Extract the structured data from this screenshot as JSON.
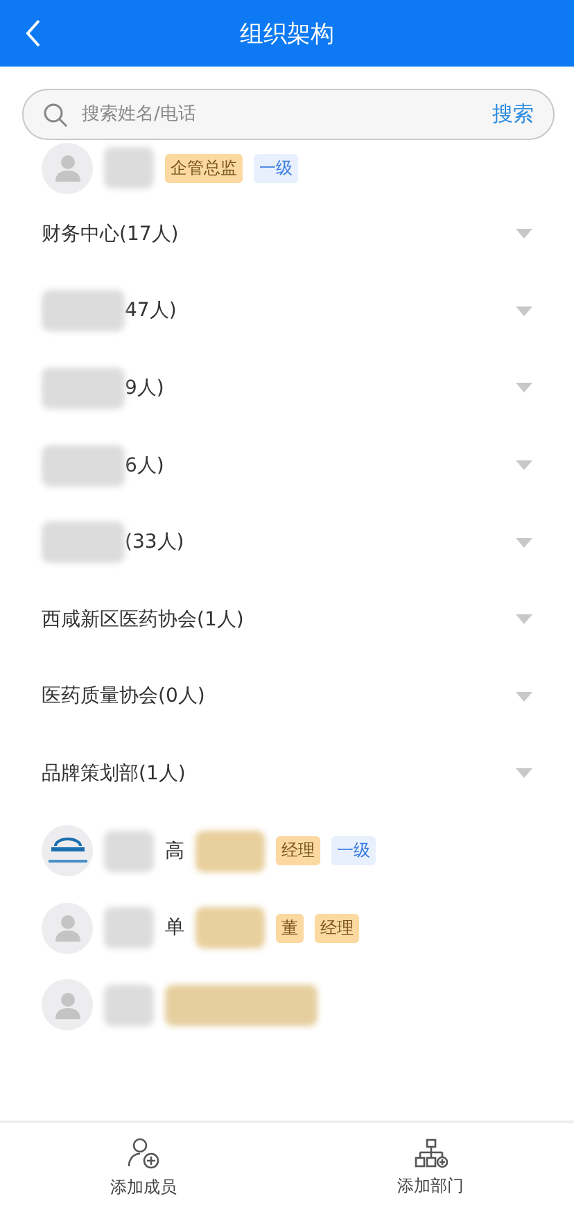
{
  "header": {
    "title": "组织架构"
  },
  "search": {
    "placeholder": "搜索姓名/电话",
    "button": "搜索"
  },
  "top_member": {
    "kind": "default",
    "tags": [
      {
        "kind": "position",
        "text": "企管总监"
      },
      {
        "kind": "level",
        "text": "一级"
      }
    ]
  },
  "departments": [
    {
      "name": "财务中心(17人)",
      "redacted": false
    },
    {
      "name": "47人)",
      "redacted": true
    },
    {
      "name": "9人)",
      "redacted": true
    },
    {
      "name": "6人)",
      "redacted": true
    },
    {
      "name": "(33人)",
      "redacted": true
    },
    {
      "name": "西咸新区医药协会(1人)",
      "redacted": false
    },
    {
      "name": "医药质量协会(0人)",
      "redacted": false
    },
    {
      "name": "品牌策划部(1人)",
      "redacted": false
    }
  ],
  "members": [
    {
      "kind": "logo",
      "name": "高",
      "tags": [
        {
          "kind": "position",
          "text": "经理"
        },
        {
          "kind": "level",
          "text": "一级"
        }
      ]
    },
    {
      "kind": "default",
      "name": "单",
      "tags": [
        {
          "kind": "position",
          "text": "董"
        },
        {
          "kind": "position",
          "text": "经理"
        }
      ]
    },
    {
      "kind": "default"
    }
  ],
  "bottom_bar": [
    {
      "kind": "member",
      "label": "添加成员"
    },
    {
      "kind": "department",
      "label": "添加部门"
    }
  ]
}
